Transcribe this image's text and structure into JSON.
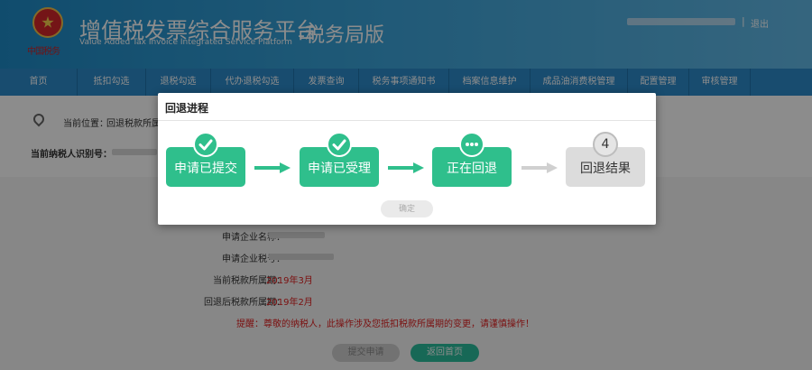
{
  "header": {
    "emblem_text": "中国税务",
    "title_cn": "增值税发票综合服务平台",
    "title_en": "Value Added Tax Invoice Integrated Service Platform",
    "title_suffix": "-税务局版",
    "separator": "|",
    "logout": "退出"
  },
  "nav": {
    "items": [
      {
        "label": "首页"
      },
      {
        "label": "抵扣勾选"
      },
      {
        "label": "退税勾选"
      },
      {
        "label": "代办退税勾选"
      },
      {
        "label": "发票查询"
      },
      {
        "label": "税务事项通知书"
      },
      {
        "label": "档案信息维护"
      },
      {
        "label": "成品油消费税管理"
      },
      {
        "label": "配置管理"
      },
      {
        "label": "审核管理"
      }
    ]
  },
  "breadcrumb": {
    "label": "当前位置：",
    "value": "回退税款所属"
  },
  "taxpayer": {
    "label": "当前纳税人识别号："
  },
  "form": {
    "company_name_label": "申请企业名称：",
    "company_tax_label": "申请企业税号：",
    "current_period_label": "当前税款所属期：",
    "current_period_value": "2019年3月",
    "rollback_period_label": "回退后税款所属期：",
    "rollback_period_value": "2019年2月",
    "warning": "提醒：尊敬的纳税人，此操作涉及您抵扣税款所属期的变更，请谨慎操作！",
    "submit_label": "提交申请",
    "home_label": "返回首页"
  },
  "modal": {
    "title": "回退进程",
    "steps": [
      {
        "label": "申请已提交",
        "status": "done",
        "icon": "check-icon"
      },
      {
        "label": "申请已受理",
        "status": "done",
        "icon": "check-icon"
      },
      {
        "label": "正在回退",
        "status": "in-progress",
        "icon": "ellipsis-icon"
      },
      {
        "label": "回退结果",
        "status": "pending",
        "number": "4"
      }
    ],
    "ok_label": "确定"
  },
  "colors": {
    "header_blue": "#2a94d2",
    "nav_blue": "#2c8bcb",
    "step_green": "#2fbf8c",
    "step_gray": "#dcdcdc",
    "warn_red": "#e02020",
    "button_teal": "#2abd9d"
  }
}
